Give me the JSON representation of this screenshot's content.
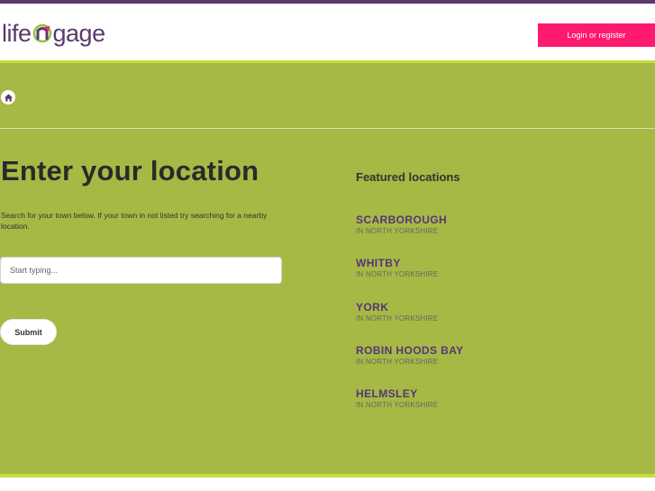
{
  "header": {
    "logo_left": "life",
    "logo_right": "gage",
    "login_label": "Login or register"
  },
  "breadcrumb": {
    "home_icon": "home-icon"
  },
  "main": {
    "title": "Enter your location",
    "intro": "Search for your town below. If your town in not listed try searching for a nearby location.",
    "search_placeholder": "Start typing...",
    "submit_label": "Submit"
  },
  "featured": {
    "title": "Featured locations",
    "items": [
      {
        "name": "SCARBOROUGH",
        "region": "IN NORTH YORKSHIRE"
      },
      {
        "name": "WHITBY",
        "region": "IN NORTH YORKSHIRE"
      },
      {
        "name": "YORK",
        "region": "IN NORTH YORKSHIRE"
      },
      {
        "name": "ROBIN HOODS BAY",
        "region": "IN NORTH YORKSHIRE"
      },
      {
        "name": "HELMSLEY",
        "region": "IN NORTH YORKSHIRE"
      }
    ]
  },
  "colors": {
    "brand_purple": "#5b3a6e",
    "accent_pink": "#ff1a6f",
    "main_green": "#a6b944",
    "highlight_green": "#c5de3a"
  }
}
